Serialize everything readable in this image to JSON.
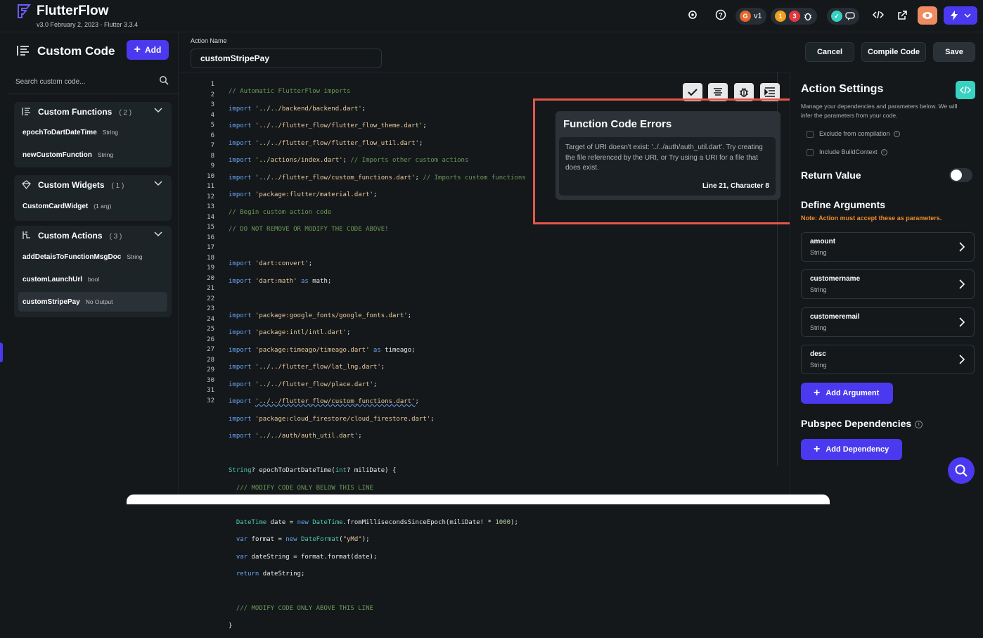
{
  "app": {
    "title": "FlutterFlow",
    "version": "v3.0 February 2, 2023 - Flutter 3.3.4",
    "version_badge": "v1",
    "badge_orange": "1",
    "badge_red": "3"
  },
  "sidebar": {
    "title": "Custom Code",
    "add_label": "Add",
    "search_placeholder": "Search custom code...",
    "sections": [
      {
        "name": "Custom Functions",
        "count": "( 2 )",
        "items": [
          {
            "name": "epochToDartDateTime",
            "type": "String"
          },
          {
            "name": "newCustomFunction",
            "type": "String"
          }
        ]
      },
      {
        "name": "Custom Widgets",
        "count": "( 1 )",
        "items": [
          {
            "name": "CustomCardWidget",
            "type": "(1 arg)"
          }
        ]
      },
      {
        "name": "Custom Actions",
        "count": "( 3 )",
        "items": [
          {
            "name": "addDetaisToFunctionMsgDoc",
            "type": "String"
          },
          {
            "name": "customLaunchUrl",
            "type": "bool"
          },
          {
            "name": "customStripePay",
            "type": "No Output"
          }
        ]
      }
    ]
  },
  "header": {
    "action_name_label": "Action Name",
    "action_name_value": "customStripePay",
    "cancel": "Cancel",
    "compile": "Compile Code",
    "save": "Save"
  },
  "editor": {
    "line_numbers": [
      "1",
      "2",
      "3",
      "4",
      "5",
      "6",
      "7",
      "8",
      "9",
      "10",
      "11",
      "12",
      "13",
      "14",
      "15",
      "16",
      "17",
      "18",
      "19",
      "20",
      "21",
      "22",
      "23",
      "24",
      "25",
      "26",
      "27",
      "28",
      "29",
      "30",
      "31",
      "32"
    ]
  },
  "error_popup": {
    "title": "Function Code Errors",
    "message": "Target of URI doesn't exist: '../../auth/auth_util.dart'. Try creating the file referenced by the URI, or Try using a URI for a file that does exist.",
    "location": "Line 21, Character 8"
  },
  "settings": {
    "title": "Action Settings",
    "description": "Manage your dependencies and parameters below. We will infer the parameters from your code.",
    "exclude_label": "Exclude from compilation",
    "include_label": "Include BuildContext",
    "return_value": "Return Value",
    "define_arguments": "Define Arguments",
    "note": "Note: Action must accept these as parameters.",
    "arguments": [
      {
        "name": "amount",
        "type": "String"
      },
      {
        "name": "customername",
        "type": "String"
      },
      {
        "name": "customeremail",
        "type": "String"
      },
      {
        "name": "desc",
        "type": "String"
      }
    ],
    "add_argument": "Add Argument",
    "pubspec": "Pubspec Dependencies",
    "add_dependency": "Add Dependency"
  },
  "colors": {
    "primary": "#4b39ef",
    "accent_teal": "#39d2c0",
    "error_outline": "#e3574a",
    "warning": "#ee8b2b"
  }
}
